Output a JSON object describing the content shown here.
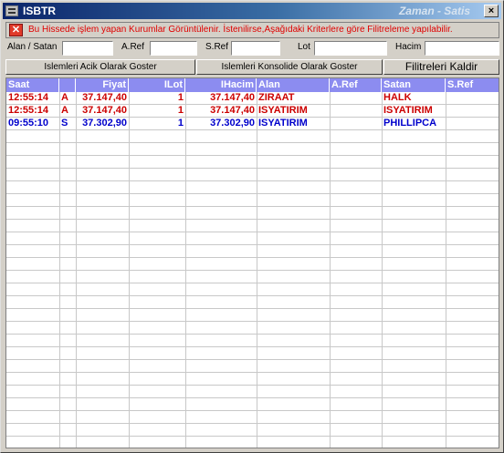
{
  "window": {
    "title": "ISBTR",
    "right_title": "Zaman - Satis",
    "close_glyph": "×"
  },
  "info": {
    "icon": "x-icon",
    "icon_glyph": "✕",
    "message": "Bu Hissede işlem yapan Kurumlar Görüntülenir. İstenilirse,Aşağıdaki Kriterlere göre Filitreleme yapılabilir."
  },
  "filters": {
    "alan_satan_label": "Alan / Satan",
    "aref_label": "A.Ref",
    "sref_label": "S.Ref",
    "lot_label": "Lot",
    "hacim_label": "Hacim",
    "alan_satan_value": "",
    "aref_value": "",
    "sref_value": "",
    "lot_value": "",
    "hacim_value": ""
  },
  "buttons": {
    "acik": "Islemleri Acik Olarak Goster",
    "konsolide": "Islemleri Konsolide Olarak Goster",
    "kaldir": "Filitreleri Kaldir"
  },
  "table": {
    "columns": [
      "Saat",
      "",
      "Fiyat",
      "ILot",
      "IHacim",
      "Alan",
      "A.Ref",
      "Satan",
      "S.Ref"
    ],
    "rows": [
      {
        "saat": "12:55:14",
        "side": "A",
        "fiyat": "37.147,40",
        "lot": "1",
        "hacim": "37.147,40",
        "alan": "ZIRAAT",
        "aref": "",
        "satan": "HALK",
        "sref": "",
        "color": "#cc0000"
      },
      {
        "saat": "12:55:14",
        "side": "A",
        "fiyat": "37.147,40",
        "lot": "1",
        "hacim": "37.147,40",
        "alan": "ISYATIRIM",
        "aref": "",
        "satan": "ISYATIRIM",
        "sref": "",
        "color": "#cc0000"
      },
      {
        "saat": "09:55:10",
        "side": "S",
        "fiyat": "37.302,90",
        "lot": "1",
        "hacim": "37.302,90",
        "alan": "ISYATIRIM",
        "aref": "",
        "satan": "PHILLIPCA",
        "sref": "",
        "color": "#0000cc"
      }
    ]
  },
  "colors": {
    "header_bg": "#8c8cf0",
    "buy": "#cc0000",
    "sell": "#0000cc"
  }
}
